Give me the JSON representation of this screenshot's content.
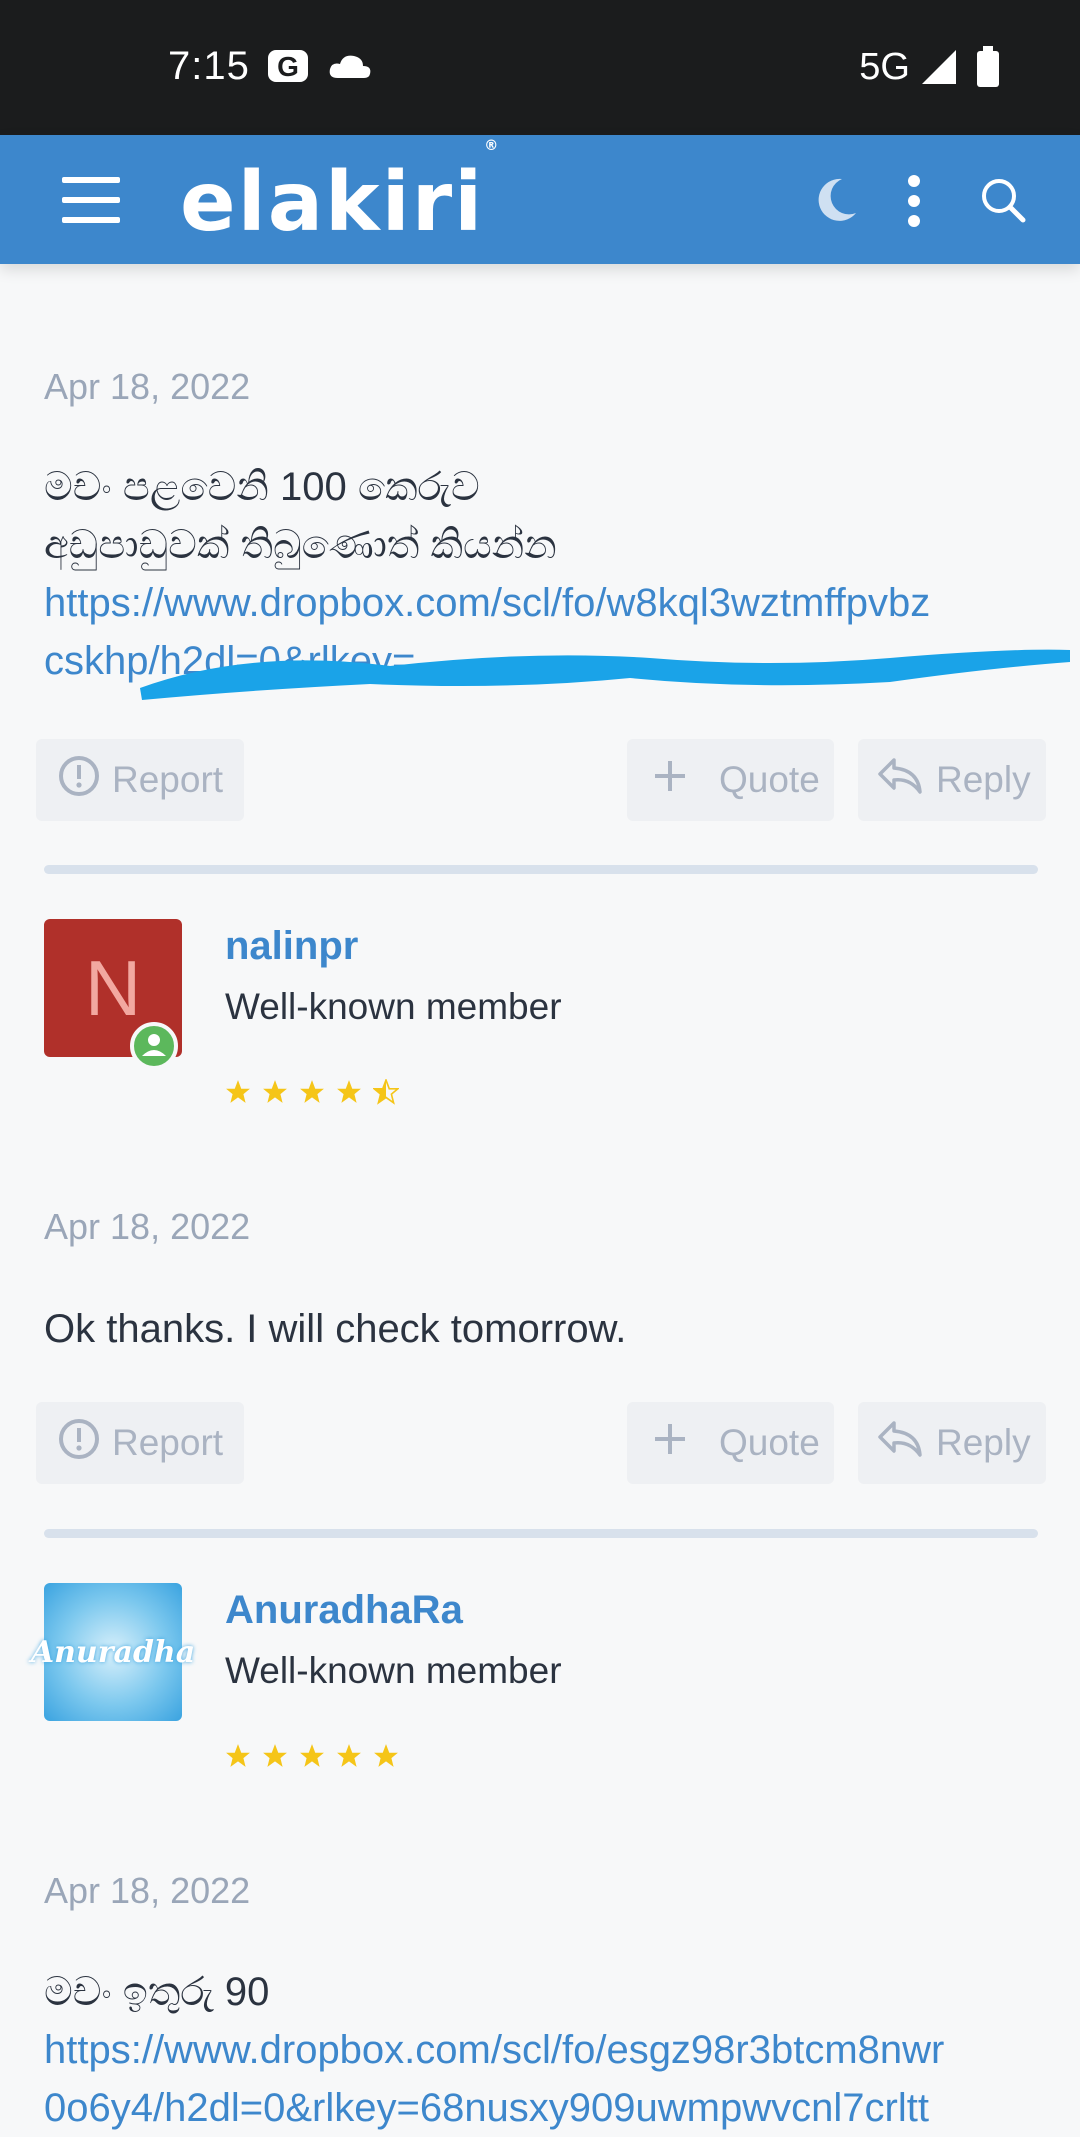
{
  "status_bar": {
    "time": "7:15",
    "carrier_icon": "G",
    "network": "5G"
  },
  "app": {
    "logo": "elakiri",
    "logo_mark": "®"
  },
  "colors": {
    "brand": "#3d87cc",
    "star": "#f5c518",
    "avatar_n": "#b0302a",
    "online": "#5cb85c"
  },
  "posts": [
    {
      "date": "Apr 18, 2022",
      "text_lines": [
        "මචං පළවෙනි 100 කෙරුව",
        "අඩුපාඩුවක් තිබුණොත් කියන්න"
      ],
      "link": "https://www.dropbox.com/scl/fo/w8kql3wztmffpvbz",
      "link_cont": "cskhp/h2dl=0&rlkey=                   ",
      "actions": {
        "report": "Report",
        "quote": "Quote",
        "reply": "Reply"
      }
    },
    {
      "user": {
        "name": "nalinpr",
        "role": "Well-known member",
        "avatar_letter": "N",
        "rating": 4.5
      },
      "date": "Apr 18, 2022",
      "text": "Ok thanks. I will check tomorrow.",
      "actions": {
        "report": "Report",
        "quote": "Quote",
        "reply": "Reply"
      }
    },
    {
      "user": {
        "name": "AnuradhaRa",
        "role": "Well-known member",
        "avatar_text": "Anuradha",
        "rating": 5
      },
      "date": "Apr 18, 2022",
      "text": "මචං ඉතුරු 90",
      "link": "https://www.dropbox.com/scl/fo/esgz98r3btcm8nwr",
      "link_cont": "0o6y4/h2dl=0&rlkey=68nusxy909uwmpwvcnl7crltt"
    }
  ]
}
